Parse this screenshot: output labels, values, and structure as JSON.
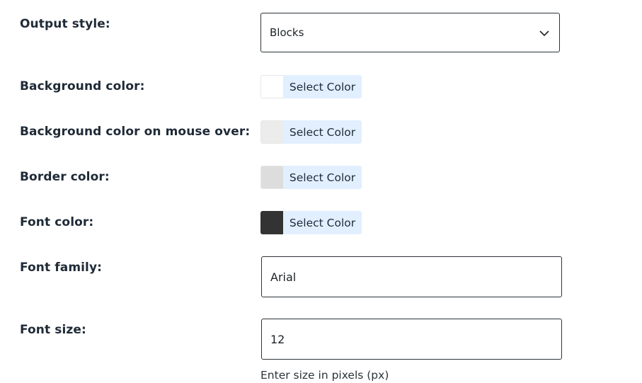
{
  "output_style": {
    "label": "Output style:",
    "value": "Blocks",
    "icon": "chevron-down-icon"
  },
  "background_color": {
    "label": "Background color:",
    "button": "Select Color",
    "swatch": "#ffffff"
  },
  "background_hover_color": {
    "label": "Background color on mouse over:",
    "button": "Select Color",
    "swatch": "#ececec"
  },
  "border_color": {
    "label": "Border color:",
    "button": "Select Color",
    "swatch": "#dddddd"
  },
  "font_color": {
    "label": "Font color:",
    "button": "Select Color",
    "swatch": "#333333"
  },
  "font_family": {
    "label": "Font family:",
    "value": "Arial"
  },
  "font_size": {
    "label": "Font size:",
    "value": "12",
    "hint": "Enter size in pixels (px)"
  },
  "colors": {
    "button_bg": "#e1efff",
    "input_border": "#2c3338"
  }
}
